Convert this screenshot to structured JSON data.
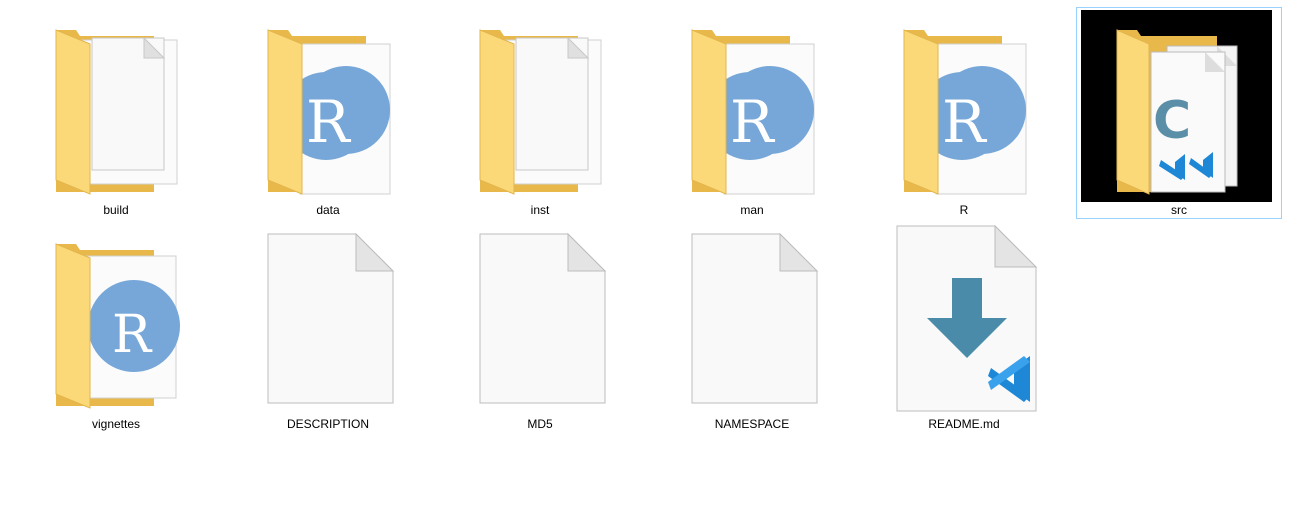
{
  "explorer": {
    "items": [
      {
        "name": "build",
        "kind": "folder-blank"
      },
      {
        "name": "data",
        "kind": "folder-r"
      },
      {
        "name": "inst",
        "kind": "folder-blank"
      },
      {
        "name": "man",
        "kind": "folder-r"
      },
      {
        "name": "R",
        "kind": "folder-r"
      },
      {
        "name": "src",
        "kind": "folder-src",
        "selected": true
      },
      {
        "name": "vignettes",
        "kind": "folder-r-single"
      },
      {
        "name": "DESCRIPTION",
        "kind": "file-blank"
      },
      {
        "name": "MD5",
        "kind": "file-blank"
      },
      {
        "name": "NAMESPACE",
        "kind": "file-blank"
      },
      {
        "name": "README.md",
        "kind": "file-markdown-vscode"
      }
    ]
  },
  "icons": {
    "folder": "folder-icon",
    "r_logo": "r-logo-icon",
    "vscode": "vscode-icon",
    "c_file": "c-file-icon",
    "download_arrow": "download-arrow-icon"
  },
  "colors": {
    "folder_back": "#E8B94A",
    "folder_front": "#FCD978",
    "r_circle": "#76A7D8",
    "arrow": "#4A8BAA",
    "vscode": "#1E88D6",
    "selection_border": "#99D1FF",
    "src_bg": "#000000"
  }
}
